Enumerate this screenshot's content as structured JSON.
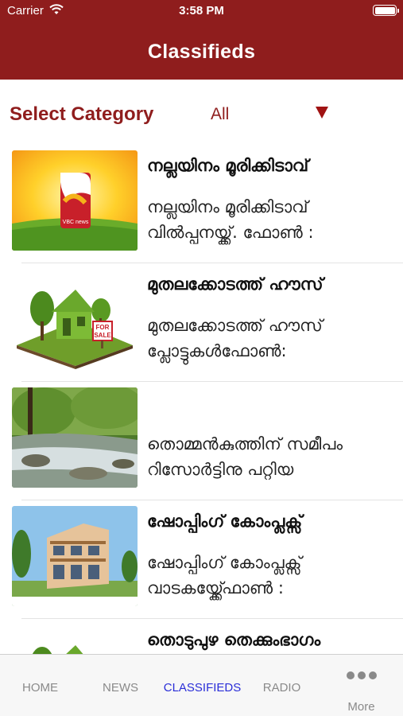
{
  "status_bar": {
    "carrier": "Carrier",
    "time": "3:58 PM"
  },
  "header": {
    "title": "Classifieds"
  },
  "filter": {
    "label": "Select Category",
    "selected": "All"
  },
  "classifieds": [
    {
      "title": "നല്ലയിനം മൂരിക്കിടാവ്",
      "desc_line1": "നല്ലയിനം മൂരിക്കിടാവ്",
      "desc_line2": "വിൽപ്പനയ്ക്ക്. ഫോൺ :",
      "image": "vbc-news-logo"
    },
    {
      "title": "മുതലക്കോടത്ത് ഹൗസ്",
      "desc_line1": "മുതലക്കോടത്ത് ഹൗസ്",
      "desc_line2": "പ്ലോട്ടുകൾഫോൺ:",
      "image": "house-for-sale"
    },
    {
      "title": "",
      "desc_line1": "തൊമ്മൻകുത്തിന് സമീപം",
      "desc_line2": "റിസോർട്ടിനു പറ്റിയ",
      "image": "river-forest"
    },
    {
      "title": "ഷോപ്പിംഗ് കോംപ്ലക്സ്",
      "desc_line1": "ഷോപ്പിംഗ് കോംപ്ലക്സ്",
      "desc_line2": "വാടകയ്ക്ക്ഫോൺ :",
      "image": "shopping-complex"
    },
    {
      "title": "തൊടുപുഴ തെക്കുംഭാഗം",
      "desc_line1": "",
      "desc_line2": "",
      "image": "house-for-sale"
    }
  ],
  "tab_bar": {
    "home": "HOME",
    "news": "NEWS",
    "classifieds": "CLASSIFIEDS",
    "radio": "RADIO",
    "more": "More"
  },
  "colors": {
    "brand": "#8f1d1d",
    "active_tab": "#2a2ed8"
  }
}
